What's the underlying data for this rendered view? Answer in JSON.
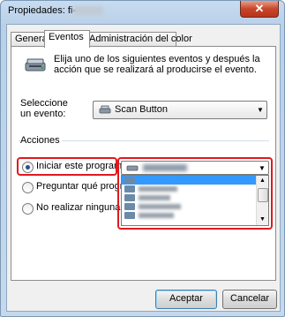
{
  "window": {
    "title": "Propiedades: fi-",
    "close_glyph": "✕"
  },
  "tabs": [
    {
      "label": "General"
    },
    {
      "label": "Eventos"
    },
    {
      "label": "Administración del color"
    }
  ],
  "description": "Elija uno de los siguientes eventos y después la acción que se realizará al producirse el evento.",
  "event_select": {
    "label": "Seleccione un evento:",
    "value": "Scan Button",
    "icon": "scanner-icon"
  },
  "actions": {
    "group_label": "Acciones",
    "options": [
      {
        "label": "Iniciar este programa:",
        "checked": true
      },
      {
        "label": "Preguntar qué programa",
        "checked": false
      },
      {
        "label": "No realizar ninguna ac",
        "checked": false
      }
    ]
  },
  "buttons": {
    "ok": "Aceptar",
    "cancel": "Cancelar"
  },
  "colors": {
    "highlight_border": "#e0191e",
    "list_selection": "#3399ff"
  }
}
